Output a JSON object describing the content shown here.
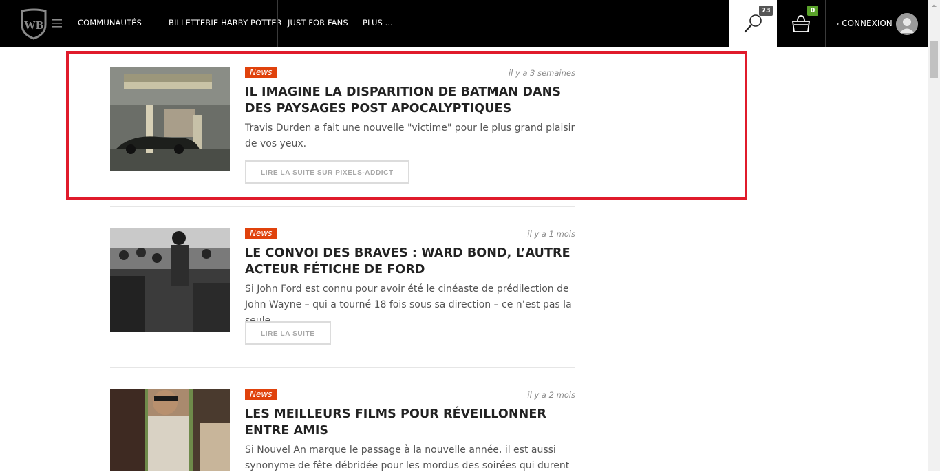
{
  "nav": {
    "items": [
      "COMMUNAUTÉS",
      "BILLETTERIE HARRY POTTER",
      "JUST FOR FANS",
      "PLUS ..."
    ],
    "search_count": "73",
    "cart_count": "0",
    "login_label": "CONNEXION",
    "icons": {
      "logo": "wb-shield-logo",
      "menu": "hamburger-icon",
      "search": "search-icon",
      "cart": "basket-icon",
      "login": "chevron-right-icon",
      "avatar": "user-avatar-icon"
    }
  },
  "articles": [
    {
      "tag": "News",
      "date": "il y a 3 semaines",
      "title": "IL IMAGINE LA DISPARITION DE BATMAN DANS DES PAYSAGES POST APOCALYPTIQUES",
      "excerpt": "Travis Durden a fait une nouvelle \"victime\" pour le plus grand plaisir de vos yeux.",
      "button": "LIRE LA SUITE SUR PIXELS-ADDICT"
    },
    {
      "tag": "News",
      "date": "il y a 1 mois",
      "title": "LE CONVOI DES BRAVES : WARD BOND, L’AUTRE ACTEUR FÉTICHE DE FORD",
      "excerpt": "Si John Ford est connu pour avoir été le cinéaste de prédilection de John Wayne – qui a tourné 18 fois sous sa direction – ce n’est pas la seule…",
      "button": "LIRE LA SUITE"
    },
    {
      "tag": "News",
      "date": "il y a 2 mois",
      "title": "LES MEILLEURS FILMS POUR RÉVEILLONNER ENTRE AMIS",
      "excerpt": "Si Nouvel An marque le passage à la nouvelle année, il est aussi synonyme de fête débridée pour les mordus des soirées qui durent",
      "button": ""
    }
  ],
  "colors": {
    "tag_bg": "#e0420c",
    "highlight_border": "#e01b2b",
    "cart_badge": "#5aa32a",
    "search_badge": "#555555"
  }
}
